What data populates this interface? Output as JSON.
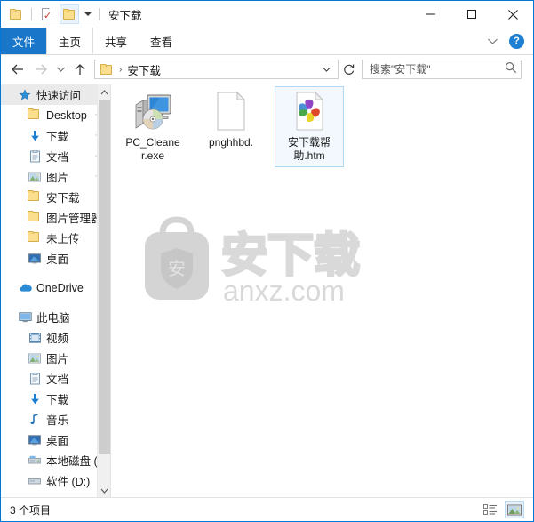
{
  "window": {
    "title": "安下载",
    "accent_color": "#0078d7",
    "tab_file_bg": "#1976c8",
    "selection_bg": "#f2f8fd",
    "selection_border": "#aed8f4"
  },
  "quick_access_toolbar": {
    "items": [
      {
        "name": "folder-icon",
        "label": "属性"
      },
      {
        "name": "properties-icon",
        "label": "属性"
      },
      {
        "name": "folder-icon-active",
        "label": "新建文件夹"
      }
    ],
    "customize_label": "自定义快速访问工具栏"
  },
  "window_controls": {
    "minimize": "最小化",
    "maximize": "最大化",
    "close": "关闭"
  },
  "ribbon": {
    "tabs": [
      {
        "label": "文件",
        "state": "file"
      },
      {
        "label": "主页",
        "state": "active"
      },
      {
        "label": "共享",
        "state": "normal"
      },
      {
        "label": "查看",
        "state": "normal"
      }
    ],
    "expand_label": "展开功能区",
    "help_label": "?"
  },
  "address": {
    "back_label": "后退",
    "forward_label": "前进",
    "recent_label": "最近浏览的位置",
    "up_label": "上移到",
    "breadcrumb": "安下载",
    "breadcrumb_separator": "›",
    "refresh_label": "刷新",
    "dropdown_label": "以前的位置"
  },
  "search": {
    "placeholder": "搜索\"安下载\"",
    "value": "",
    "icon": "search-icon"
  },
  "sidebar": {
    "items": [
      {
        "label": "快速访问",
        "icon": "star-icon",
        "level": 0,
        "selected": true,
        "pinned": false
      },
      {
        "label": "Desktop",
        "icon": "folder-icon",
        "level": 1,
        "selected": false,
        "pinned": true
      },
      {
        "label": "下载",
        "icon": "download-icon",
        "level": 1,
        "selected": false,
        "pinned": true
      },
      {
        "label": "文档",
        "icon": "documents-icon",
        "level": 1,
        "selected": false,
        "pinned": true
      },
      {
        "label": "图片",
        "icon": "pictures-icon",
        "level": 1,
        "selected": false,
        "pinned": true
      },
      {
        "label": "安下载",
        "icon": "folder-icon",
        "level": 1,
        "selected": false,
        "pinned": false
      },
      {
        "label": "图片管理器",
        "icon": "folder-icon",
        "level": 1,
        "selected": false,
        "pinned": false
      },
      {
        "label": "未上传",
        "icon": "folder-icon",
        "level": 1,
        "selected": false,
        "pinned": false
      },
      {
        "label": "桌面",
        "icon": "desktop-icon",
        "level": 1,
        "selected": false,
        "pinned": false
      },
      {
        "label": "OneDrive",
        "icon": "onedrive-icon",
        "level": 0,
        "selected": false,
        "pinned": false
      },
      {
        "label": "此电脑",
        "icon": "thispc-icon",
        "level": 0,
        "selected": false,
        "pinned": false
      },
      {
        "label": "视频",
        "icon": "videos-icon",
        "level": 1,
        "selected": false,
        "pinned": false
      },
      {
        "label": "图片",
        "icon": "pictures-icon",
        "level": 1,
        "selected": false,
        "pinned": false
      },
      {
        "label": "文档",
        "icon": "documents-icon",
        "level": 1,
        "selected": false,
        "pinned": false
      },
      {
        "label": "下载",
        "icon": "download-icon",
        "level": 1,
        "selected": false,
        "pinned": false
      },
      {
        "label": "音乐",
        "icon": "music-icon",
        "level": 1,
        "selected": false,
        "pinned": false
      },
      {
        "label": "桌面",
        "icon": "desktop-icon",
        "level": 1,
        "selected": false,
        "pinned": false
      },
      {
        "label": "本地磁盘 (C",
        "icon": "drive-icon",
        "level": 1,
        "selected": false,
        "pinned": false
      },
      {
        "label": "软件 (D:)",
        "icon": "drive-icon",
        "level": 1,
        "selected": false,
        "pinned": false
      }
    ],
    "scrollbar": {
      "up_label": "向上滚动",
      "down_label": "向下滚动"
    }
  },
  "files": [
    {
      "name": "PC_Cleaner.exe",
      "display_line1": "PC_Cleane",
      "display_line2": "r.exe",
      "icon": "computer-cd-icon",
      "selected": false
    },
    {
      "name": "pnghhbd.",
      "display_line1": "pnghhbd.",
      "display_line2": "",
      "icon": "blank-document-icon",
      "selected": false
    },
    {
      "name": "安下载帮助.htm",
      "display_line1": "安下载帮",
      "display_line2": "助.htm",
      "icon": "html-pinwheel-icon",
      "selected": true
    }
  ],
  "watermark": {
    "logo_char": "安",
    "brand": "安下载",
    "site": "anxz.com",
    "color": "#d6d6d6"
  },
  "statusbar": {
    "item_count_text": "3 个项目",
    "views": [
      {
        "name": "details-view-button",
        "label": "详细信息",
        "active": false
      },
      {
        "name": "large-icons-view-button",
        "label": "大图标",
        "active": true
      }
    ]
  }
}
